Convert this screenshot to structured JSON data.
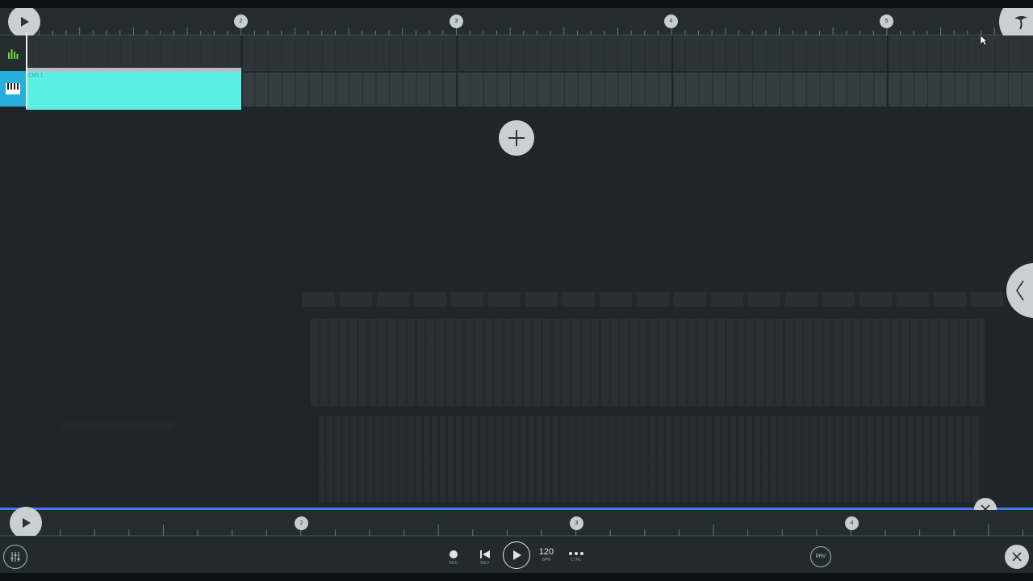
{
  "colors": {
    "accent_cyan": "#5cefe6",
    "track_icon_active": "#27aedb",
    "selection_line": "#3f7ee6",
    "button_face": "#c9cfd2"
  },
  "playlist": {
    "bar_markers": [
      "2",
      "3",
      "4",
      "5"
    ],
    "clip": {
      "label": "CMS 1"
    },
    "add_button_icon": "plus-icon"
  },
  "editor": {
    "bar_markers": [
      "2",
      "3",
      "4"
    ]
  },
  "transport": {
    "rec_label": "REC",
    "rev_label": "REV",
    "tempo": "120",
    "tempo_label": "BPM",
    "ctrl_label": "CTRL",
    "prv_label": "PRV"
  }
}
